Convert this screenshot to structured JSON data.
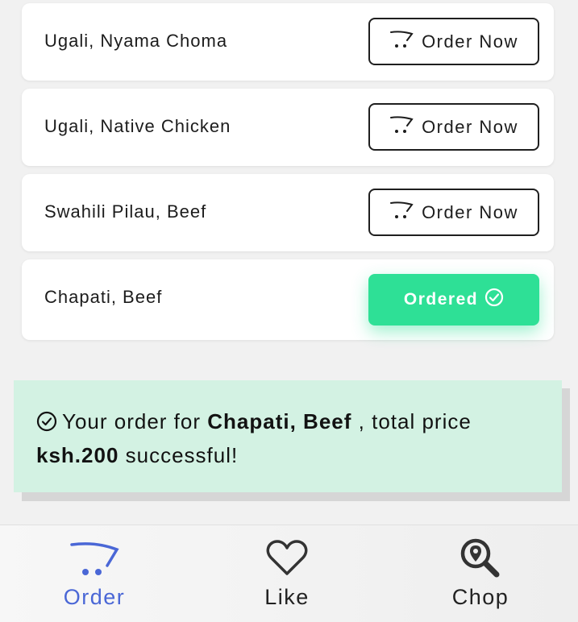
{
  "colors": {
    "accent": "#4a67d6",
    "ordered": "#2ee096",
    "alert_bg": "#d3f2e3"
  },
  "menu": {
    "items": [
      {
        "name": "Ugali, Nyama Choma",
        "button_label": "Order Now",
        "button_icon": "cart-icon"
      },
      {
        "name": "Ugali, Native Chicken",
        "button_label": "Order Now",
        "button_icon": "cart-icon"
      },
      {
        "name": "Swahili Pilau, Beef",
        "button_label": "Order Now",
        "button_icon": "cart-icon"
      },
      {
        "name": "Chapati, Beef",
        "button_label": "Ordered",
        "button_icon": "check-circle-icon"
      }
    ]
  },
  "alert": {
    "icon": "check-circle-icon",
    "prefix": "Your order for",
    "item": "Chapati, Beef",
    "middle": ", total price",
    "price": "ksh.200",
    "suffix": "successful!"
  },
  "nav": {
    "items": [
      {
        "label": "Order",
        "icon": "cart-icon",
        "active": true
      },
      {
        "label": "Like",
        "icon": "heart-icon",
        "active": false
      },
      {
        "label": "Chop",
        "icon": "location-search-icon",
        "active": false
      }
    ]
  }
}
